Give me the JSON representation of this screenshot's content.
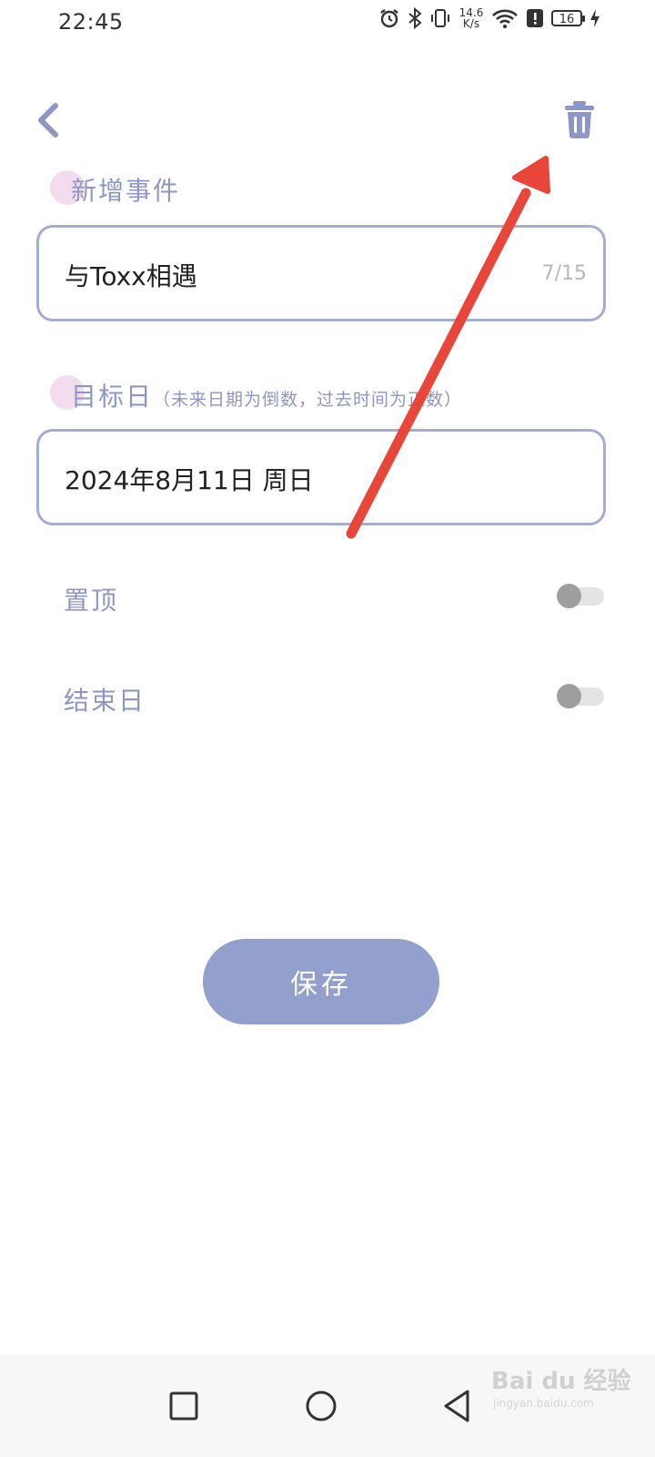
{
  "status_bar": {
    "time": "22:45",
    "net_speed_value": "14.6",
    "net_speed_unit": "K/s",
    "battery": "16",
    "icons": [
      "alarm-icon",
      "bluetooth-icon",
      "vibrate-icon",
      "wifi-icon",
      "alert-icon",
      "battery-icon",
      "charging-icon"
    ]
  },
  "header": {
    "back_icon": "chevron-left-icon",
    "delete_icon": "trash-icon",
    "accent_color": "#8e97c4"
  },
  "event_section": {
    "label": "新增事件",
    "value": "与Toxx相遇",
    "counter": "7/15"
  },
  "date_section": {
    "label": "目标日",
    "hint": "（未来日期为倒数，过去时间为正数）",
    "value": "2024年8月11日 周日"
  },
  "pin_row": {
    "label": "置顶",
    "toggle_on": false
  },
  "end_date_row": {
    "label": "结束日",
    "toggle_on": false
  },
  "save_button": {
    "label": "保存",
    "color": "#939fcd"
  },
  "annotation": {
    "arrow_color": "#e8463a"
  },
  "nav_bar": {
    "icons": [
      "recents-square-icon",
      "home-circle-icon",
      "back-triangle-icon"
    ]
  },
  "watermark": {
    "text": "Bai du 经验",
    "sub": "jingyan.baidu.com"
  }
}
